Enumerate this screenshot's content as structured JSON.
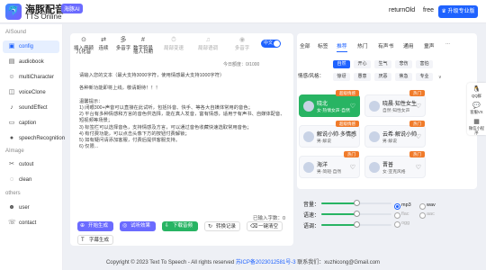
{
  "header": {
    "brand_name": "海豚配音",
    "brand_badge": "海豚AI",
    "brand_sub": "TTS Online",
    "links": [
      "returnOld",
      "free"
    ],
    "upgrade_label": "升级专业版"
  },
  "sidebar": {
    "sections": [
      {
        "title": "AISound",
        "items": [
          {
            "label": "config",
            "icon": "config-icon",
            "active": true
          },
          {
            "label": "audiobook",
            "icon": "book-icon"
          },
          {
            "label": "multiCharacter",
            "icon": "users-icon"
          },
          {
            "label": "voiceClone",
            "icon": "clone-icon"
          },
          {
            "label": "soundEffect",
            "icon": "music-icon"
          },
          {
            "label": "caption",
            "icon": "caption-icon"
          },
          {
            "label": "speechRecognition",
            "icon": "mic-icon"
          }
        ]
      },
      {
        "title": "AImage",
        "items": [
          {
            "label": "cutout",
            "icon": "scissors-icon"
          },
          {
            "label": "clean",
            "icon": "clean-icon"
          }
        ]
      },
      {
        "title": "others",
        "items": [
          {
            "label": "user",
            "icon": "user-icon"
          },
          {
            "label": "contact",
            "icon": "phone-icon"
          }
        ]
      }
    ]
  },
  "toolbar": {
    "items": [
      {
        "label": "插入停顿",
        "icon": "pause-icon"
      },
      {
        "label": "连续",
        "icon": "link-icon"
      },
      {
        "label": "多音字",
        "icon": "polyphone-icon"
      },
      {
        "label": "数字符号",
        "icon": "number-icon"
      },
      {
        "label": "儿化音",
        "icon": "erhua-icon"
      },
      {
        "label": "插入日期",
        "icon": "calendar-icon"
      },
      {
        "label": "局部变速",
        "icon": "speed-icon",
        "disabled": true
      },
      {
        "label": "局部语调",
        "icon": "pitch-icon",
        "disabled": true
      },
      {
        "label": "多音字",
        "icon": "sound-icon",
        "disabled": true
      }
    ],
    "toggle_label": "中文"
  },
  "editor": {
    "count_text": "今日额度：0/1000",
    "body": "请输入您的文本（最大支持3000字符，使用情感最大支持1000字符）\n\n各种新功能即将上线，敬请期待！！！\n\n温馨提示：\n1) 闭眼300+声音可以直接在此试听，包括抖音、快手、等各大自媒体常用的音色；\n2) 平台有多种情感和方言的音色供选择，能在真人发音，富有情感，适用于有声书、自媒体配音、短视频等场景；\n3) 标签栏可以选择音色，支持情感及方言，可以通过音色收藏快速选取常用音色；\n4) 有付费功能，可以点击头像下方的按钮付费解锁；\n5) 如有疑问请添加客服，付费后提供客服支持。\n6) 仅限...",
    "input_count": "已输入字数：0",
    "buttons": [
      {
        "label": "开始生成",
        "icon": "play-icon"
      },
      {
        "label": "试听效果",
        "icon": "listen-icon"
      },
      {
        "label": "下载音频",
        "icon": "download-icon"
      },
      {
        "label": "转换记录",
        "icon": "history-icon"
      },
      {
        "label": "一键清空",
        "icon": "clear-icon"
      },
      {
        "label": "字幕生成",
        "icon": "subtitle-icon"
      }
    ]
  },
  "voice_panel": {
    "tabs": [
      "全部",
      "标签",
      "推荐",
      "热门",
      "有声书",
      "通用",
      "童声"
    ],
    "active_tab": "推荐",
    "more": "...",
    "filter_label": "情感/风格：",
    "chips": [
      "自然",
      "开心",
      "生气",
      "悲伤",
      "害怕",
      "惊讶",
      "愚意",
      "厌恶",
      "焦急",
      "专业"
    ],
    "active_chip": "自然",
    "expand": "∨",
    "cards": [
      {
        "name": "晓北",
        "desc": "女·热情女声·自然",
        "badge": "超级情感",
        "selected": true
      },
      {
        "name": "晓晨·知性女生",
        "desc": "自然·知性女声",
        "badge": "热门"
      },
      {
        "name": "解说小帅·多情感",
        "desc": "男·解说",
        "badge": "超级情感"
      },
      {
        "name": "云希·解说小帅",
        "desc": "男·解说",
        "badge": "热门"
      },
      {
        "name": "海洋",
        "desc": "男·简短·自然",
        "badge": "热门"
      },
      {
        "name": "晋普",
        "desc": "女·亚克风格",
        "badge": "热门"
      }
    ]
  },
  "settings": {
    "sliders": [
      {
        "label": "音量：",
        "value": 0.5
      },
      {
        "label": "语速：",
        "value": 0.5
      },
      {
        "label": "语调：",
        "value": 0.5
      }
    ],
    "formats": [
      {
        "label": "mp3",
        "selected": true
      },
      {
        "label": "wav"
      },
      {
        "label": "flac",
        "disabled": true
      },
      {
        "label": "aac",
        "disabled": true
      },
      {
        "label": "ogg",
        "disabled": true
      }
    ]
  },
  "float_bar": [
    {
      "label": "QQ群",
      "icon": "qq-icon"
    },
    {
      "label": "客服VX",
      "icon": "wechat-icon"
    },
    {
      "label": "微信小程序",
      "icon": "miniapp-icon"
    }
  ],
  "footer": {
    "copyright": "Copyright © 2023 Text To Speech - All rights reserved",
    "icp": "苏ICP备2023012581号-3",
    "contact": "联系我们：xuzhicong@Gmail.com"
  },
  "colors": {
    "accent": "#1e62ff",
    "selected_card": "#28b463",
    "badge": "#f07b2a"
  }
}
